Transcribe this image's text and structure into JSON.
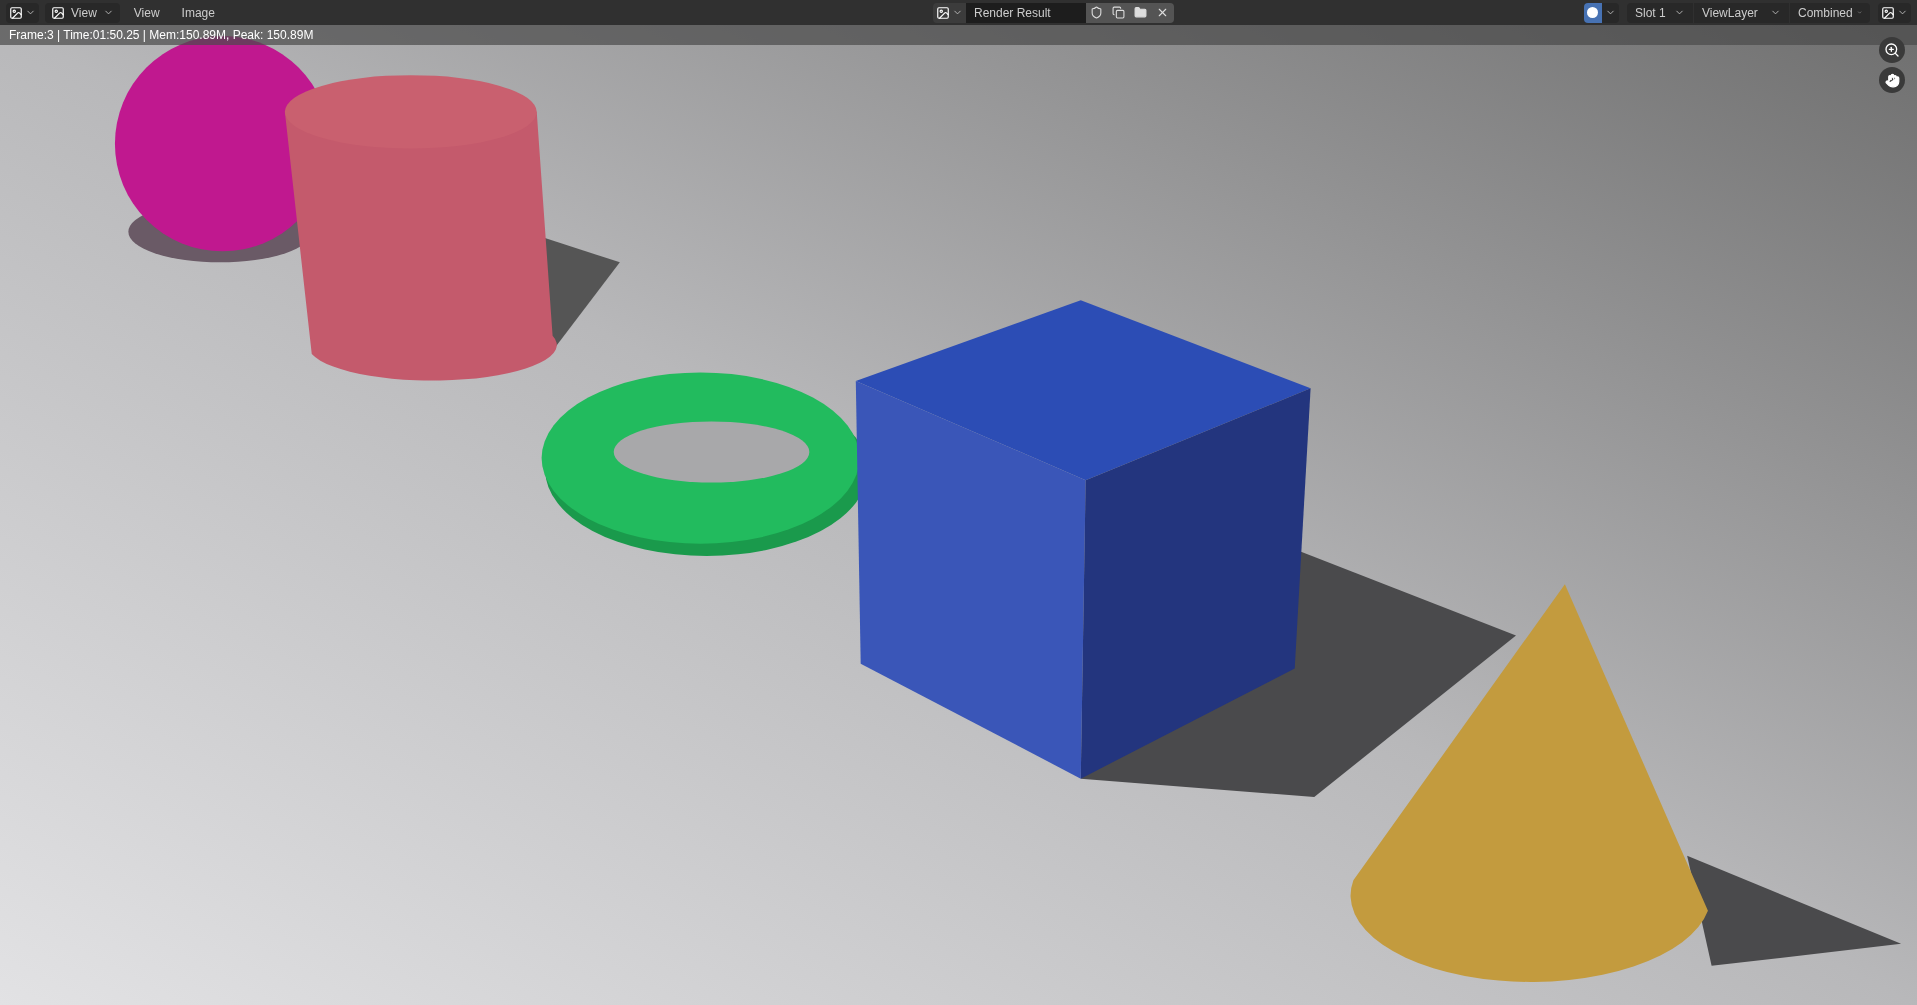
{
  "header": {
    "mode_menu": "View",
    "menus": [
      "View",
      "Image"
    ],
    "image_name": "Render Result",
    "slot": "Slot 1",
    "view_layer": "ViewLayer",
    "render_pass": "Combined"
  },
  "status": "Frame:3 | Time:01:50.25 | Mem:150.89M, Peak: 150.89M"
}
